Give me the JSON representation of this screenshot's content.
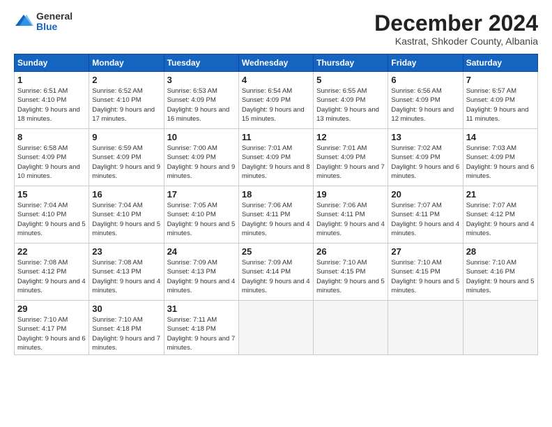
{
  "logo": {
    "general": "General",
    "blue": "Blue"
  },
  "title": "December 2024",
  "subtitle": "Kastrat, Shkoder County, Albania",
  "header_days": [
    "Sunday",
    "Monday",
    "Tuesday",
    "Wednesday",
    "Thursday",
    "Friday",
    "Saturday"
  ],
  "weeks": [
    [
      {
        "day": "1",
        "sunrise": "Sunrise: 6:51 AM",
        "sunset": "Sunset: 4:10 PM",
        "daylight": "Daylight: 9 hours and 18 minutes."
      },
      {
        "day": "2",
        "sunrise": "Sunrise: 6:52 AM",
        "sunset": "Sunset: 4:10 PM",
        "daylight": "Daylight: 9 hours and 17 minutes."
      },
      {
        "day": "3",
        "sunrise": "Sunrise: 6:53 AM",
        "sunset": "Sunset: 4:09 PM",
        "daylight": "Daylight: 9 hours and 16 minutes."
      },
      {
        "day": "4",
        "sunrise": "Sunrise: 6:54 AM",
        "sunset": "Sunset: 4:09 PM",
        "daylight": "Daylight: 9 hours and 15 minutes."
      },
      {
        "day": "5",
        "sunrise": "Sunrise: 6:55 AM",
        "sunset": "Sunset: 4:09 PM",
        "daylight": "Daylight: 9 hours and 13 minutes."
      },
      {
        "day": "6",
        "sunrise": "Sunrise: 6:56 AM",
        "sunset": "Sunset: 4:09 PM",
        "daylight": "Daylight: 9 hours and 12 minutes."
      },
      {
        "day": "7",
        "sunrise": "Sunrise: 6:57 AM",
        "sunset": "Sunset: 4:09 PM",
        "daylight": "Daylight: 9 hours and 11 minutes."
      }
    ],
    [
      {
        "day": "8",
        "sunrise": "Sunrise: 6:58 AM",
        "sunset": "Sunset: 4:09 PM",
        "daylight": "Daylight: 9 hours and 10 minutes."
      },
      {
        "day": "9",
        "sunrise": "Sunrise: 6:59 AM",
        "sunset": "Sunset: 4:09 PM",
        "daylight": "Daylight: 9 hours and 9 minutes."
      },
      {
        "day": "10",
        "sunrise": "Sunrise: 7:00 AM",
        "sunset": "Sunset: 4:09 PM",
        "daylight": "Daylight: 9 hours and 9 minutes."
      },
      {
        "day": "11",
        "sunrise": "Sunrise: 7:01 AM",
        "sunset": "Sunset: 4:09 PM",
        "daylight": "Daylight: 9 hours and 8 minutes."
      },
      {
        "day": "12",
        "sunrise": "Sunrise: 7:01 AM",
        "sunset": "Sunset: 4:09 PM",
        "daylight": "Daylight: 9 hours and 7 minutes."
      },
      {
        "day": "13",
        "sunrise": "Sunrise: 7:02 AM",
        "sunset": "Sunset: 4:09 PM",
        "daylight": "Daylight: 9 hours and 6 minutes."
      },
      {
        "day": "14",
        "sunrise": "Sunrise: 7:03 AM",
        "sunset": "Sunset: 4:09 PM",
        "daylight": "Daylight: 9 hours and 6 minutes."
      }
    ],
    [
      {
        "day": "15",
        "sunrise": "Sunrise: 7:04 AM",
        "sunset": "Sunset: 4:10 PM",
        "daylight": "Daylight: 9 hours and 5 minutes."
      },
      {
        "day": "16",
        "sunrise": "Sunrise: 7:04 AM",
        "sunset": "Sunset: 4:10 PM",
        "daylight": "Daylight: 9 hours and 5 minutes."
      },
      {
        "day": "17",
        "sunrise": "Sunrise: 7:05 AM",
        "sunset": "Sunset: 4:10 PM",
        "daylight": "Daylight: 9 hours and 5 minutes."
      },
      {
        "day": "18",
        "sunrise": "Sunrise: 7:06 AM",
        "sunset": "Sunset: 4:11 PM",
        "daylight": "Daylight: 9 hours and 4 minutes."
      },
      {
        "day": "19",
        "sunrise": "Sunrise: 7:06 AM",
        "sunset": "Sunset: 4:11 PM",
        "daylight": "Daylight: 9 hours and 4 minutes."
      },
      {
        "day": "20",
        "sunrise": "Sunrise: 7:07 AM",
        "sunset": "Sunset: 4:11 PM",
        "daylight": "Daylight: 9 hours and 4 minutes."
      },
      {
        "day": "21",
        "sunrise": "Sunrise: 7:07 AM",
        "sunset": "Sunset: 4:12 PM",
        "daylight": "Daylight: 9 hours and 4 minutes."
      }
    ],
    [
      {
        "day": "22",
        "sunrise": "Sunrise: 7:08 AM",
        "sunset": "Sunset: 4:12 PM",
        "daylight": "Daylight: 9 hours and 4 minutes."
      },
      {
        "day": "23",
        "sunrise": "Sunrise: 7:08 AM",
        "sunset": "Sunset: 4:13 PM",
        "daylight": "Daylight: 9 hours and 4 minutes."
      },
      {
        "day": "24",
        "sunrise": "Sunrise: 7:09 AM",
        "sunset": "Sunset: 4:13 PM",
        "daylight": "Daylight: 9 hours and 4 minutes."
      },
      {
        "day": "25",
        "sunrise": "Sunrise: 7:09 AM",
        "sunset": "Sunset: 4:14 PM",
        "daylight": "Daylight: 9 hours and 4 minutes."
      },
      {
        "day": "26",
        "sunrise": "Sunrise: 7:10 AM",
        "sunset": "Sunset: 4:15 PM",
        "daylight": "Daylight: 9 hours and 5 minutes."
      },
      {
        "day": "27",
        "sunrise": "Sunrise: 7:10 AM",
        "sunset": "Sunset: 4:15 PM",
        "daylight": "Daylight: 9 hours and 5 minutes."
      },
      {
        "day": "28",
        "sunrise": "Sunrise: 7:10 AM",
        "sunset": "Sunset: 4:16 PM",
        "daylight": "Daylight: 9 hours and 5 minutes."
      }
    ],
    [
      {
        "day": "29",
        "sunrise": "Sunrise: 7:10 AM",
        "sunset": "Sunset: 4:17 PM",
        "daylight": "Daylight: 9 hours and 6 minutes."
      },
      {
        "day": "30",
        "sunrise": "Sunrise: 7:10 AM",
        "sunset": "Sunset: 4:18 PM",
        "daylight": "Daylight: 9 hours and 7 minutes."
      },
      {
        "day": "31",
        "sunrise": "Sunrise: 7:11 AM",
        "sunset": "Sunset: 4:18 PM",
        "daylight": "Daylight: 9 hours and 7 minutes."
      },
      null,
      null,
      null,
      null
    ]
  ]
}
